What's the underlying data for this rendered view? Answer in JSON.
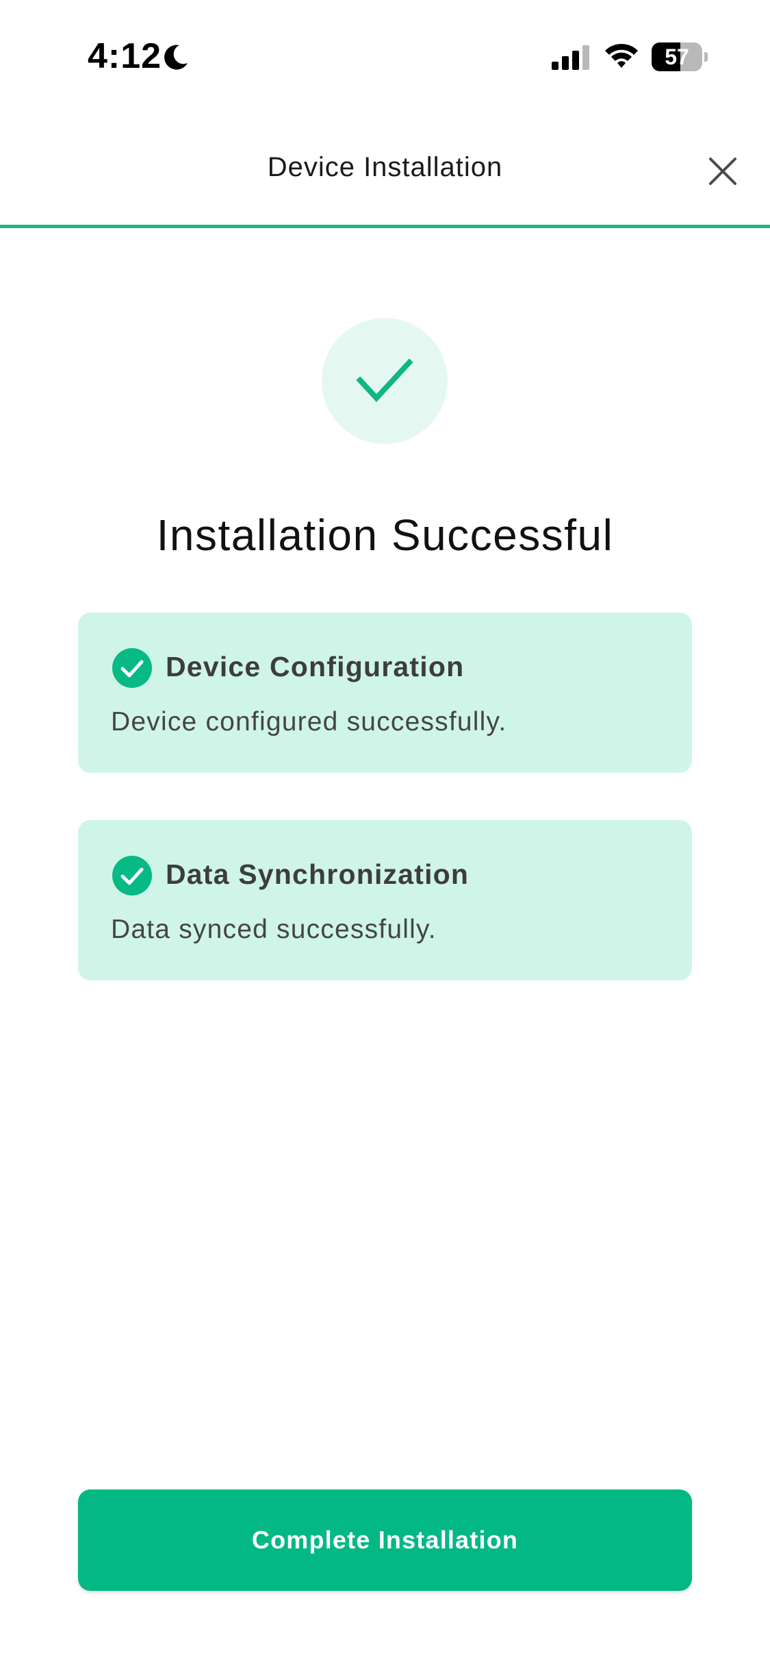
{
  "status_bar": {
    "time": "4:12",
    "battery_level": "57",
    "battery_fraction": 0.57,
    "icons": [
      "moon-icon",
      "signal-icon",
      "wifi-icon",
      "battery-icon"
    ]
  },
  "header": {
    "title": "Device Installation",
    "close_icon": "close-icon",
    "progress": 1.0
  },
  "main": {
    "success_icon": "checkmark-icon",
    "title": "Installation Successful",
    "steps": [
      {
        "icon": "check-circle-icon",
        "title": "Device Configuration",
        "description": "Device configured successfully."
      },
      {
        "icon": "check-circle-icon",
        "title": "Data Synchronization",
        "description": "Data synced successfully."
      }
    ]
  },
  "footer": {
    "button_label": "Complete Installation"
  },
  "colors": {
    "accent": "#03b884",
    "card_background": "#cff5e8",
    "success_circle": "#e4f8f1"
  }
}
